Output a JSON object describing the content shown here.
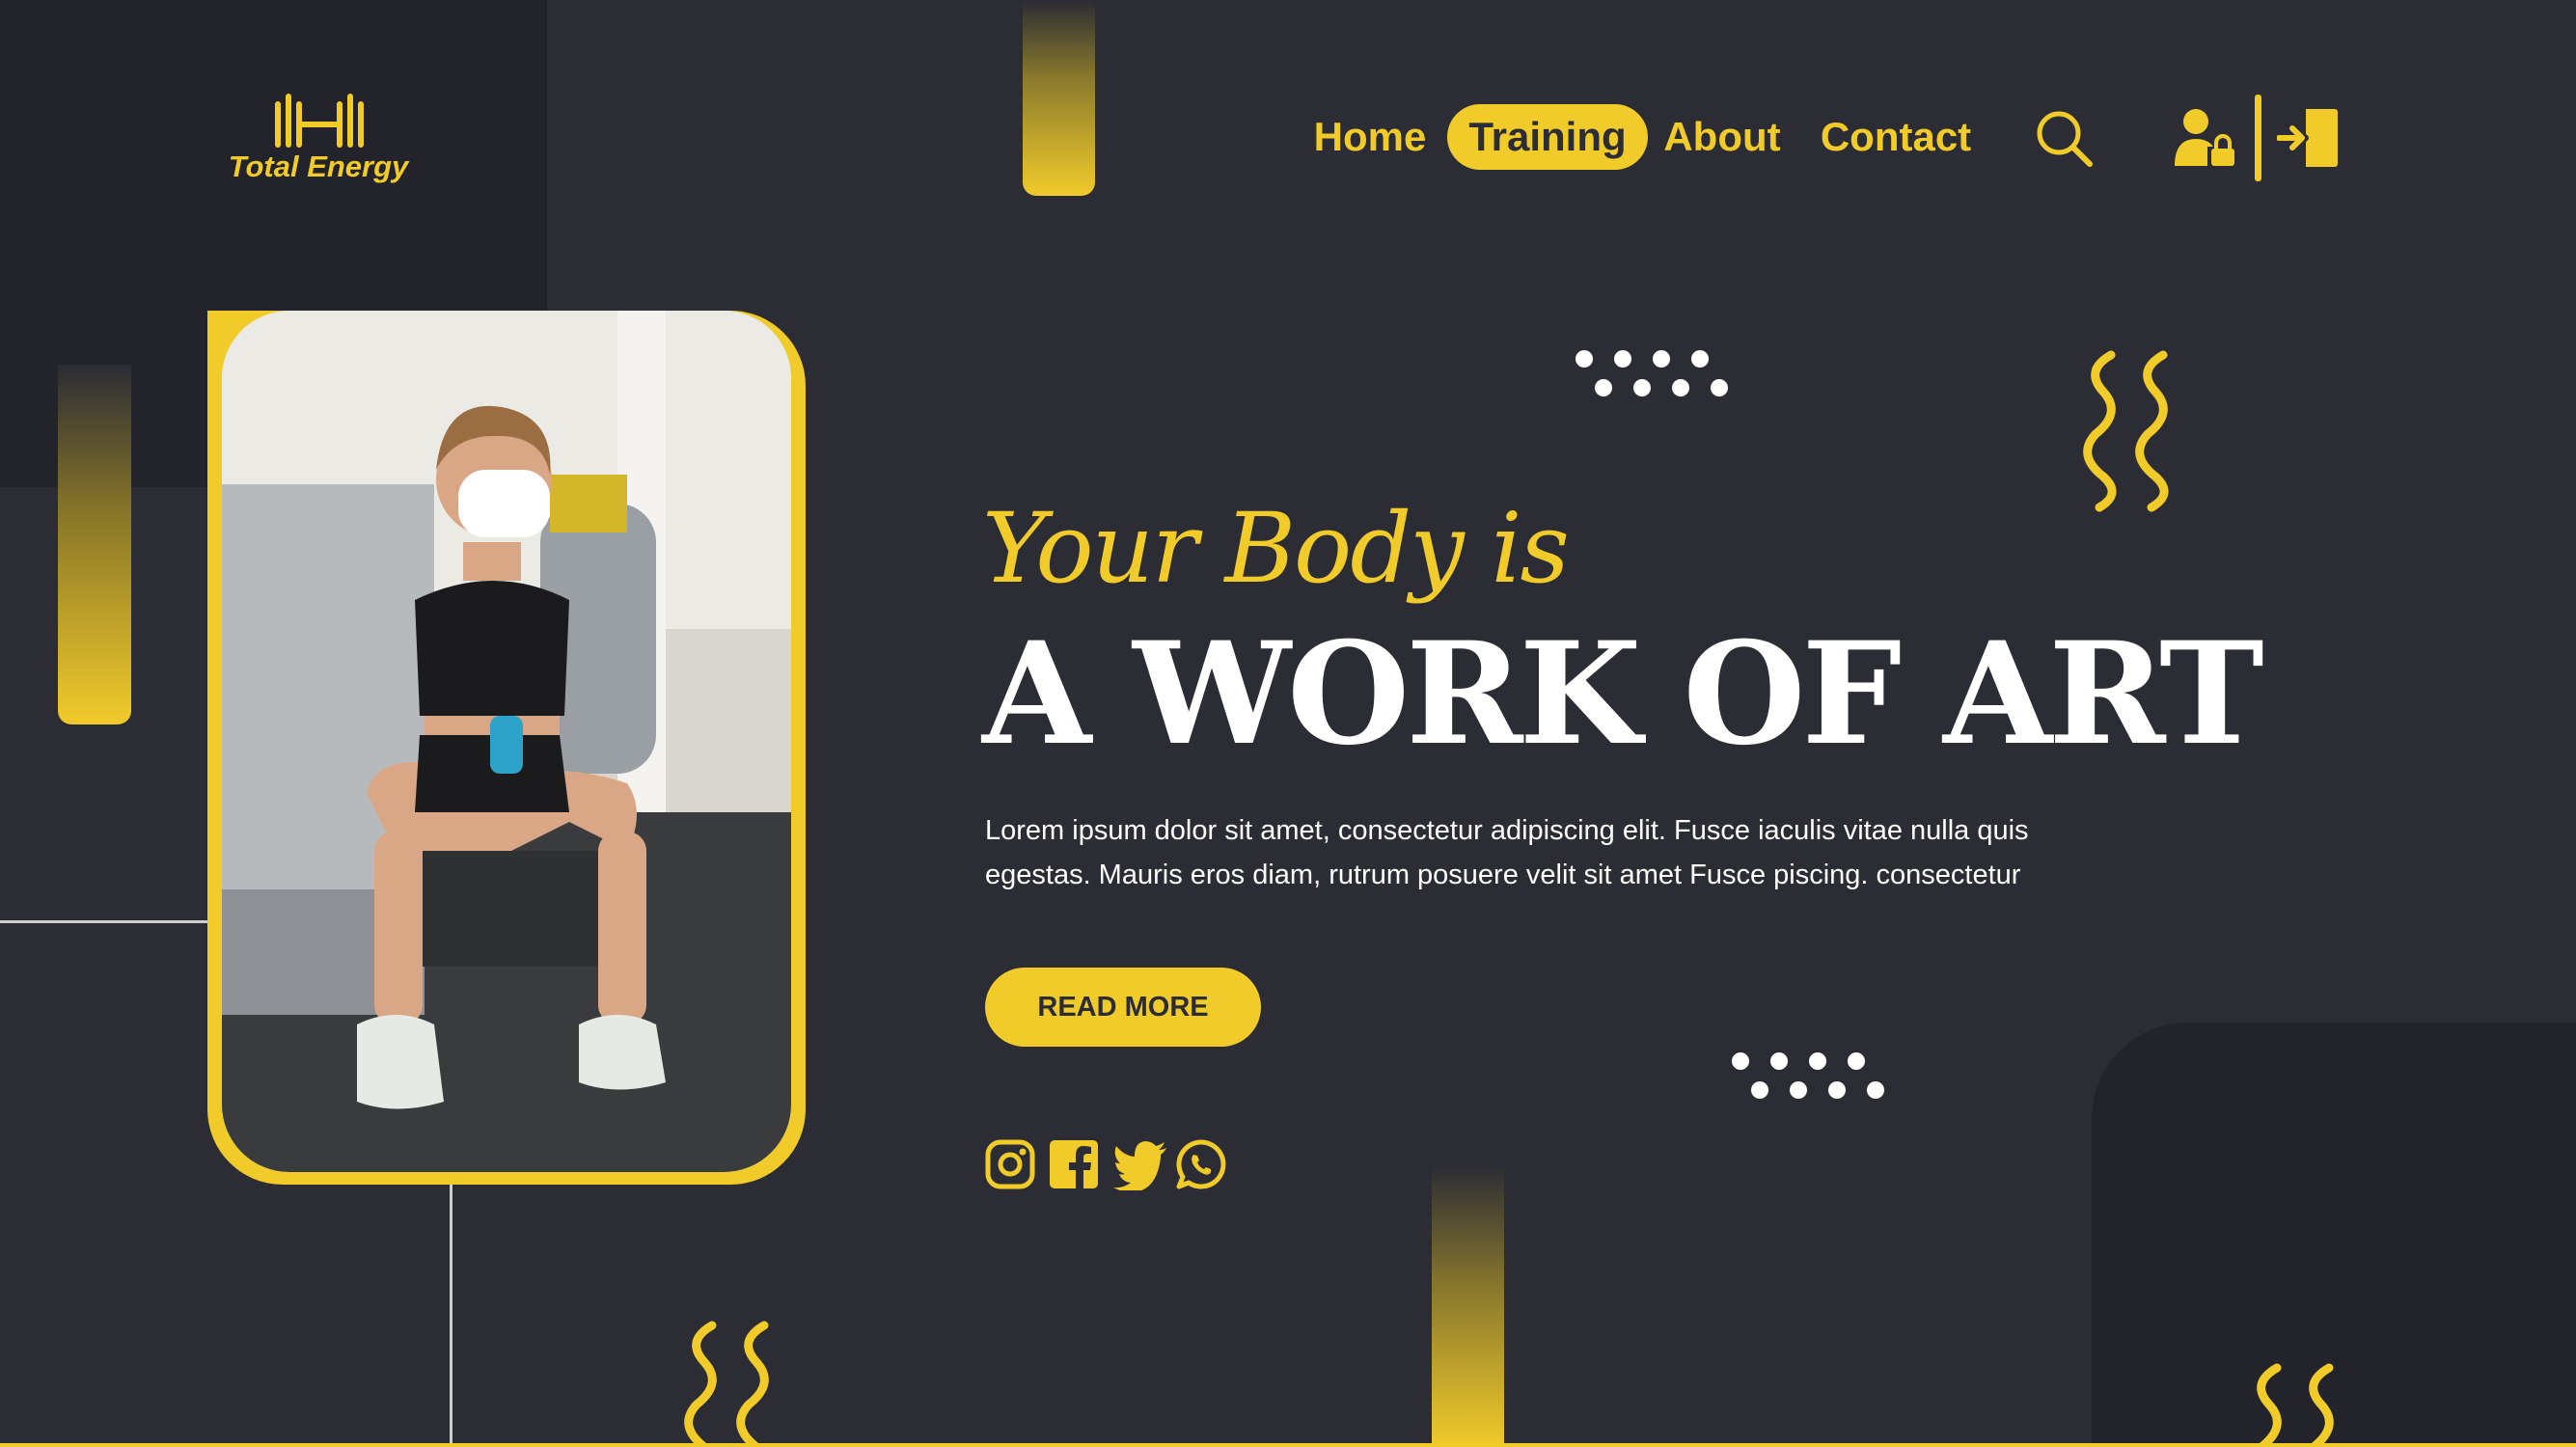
{
  "brand": {
    "name": "Total Energy"
  },
  "nav": {
    "items": [
      {
        "label": "Home",
        "active": false
      },
      {
        "label": "Training",
        "active": true
      },
      {
        "label": "About",
        "active": false
      },
      {
        "label": "Contact",
        "active": false
      }
    ],
    "icons": [
      "search-icon",
      "user-lock-icon",
      "sign-in-icon"
    ]
  },
  "hero": {
    "tagline": "Your Body is",
    "headline": "A WORK OF ART",
    "description": "Lorem ipsum dolor sit amet, consectetur adipiscing elit. Fusce iaculis vitae nulla quis egestas. Mauris eros diam, rutrum posuere velit sit amet Fusce piscing. consectetur",
    "cta_label": "READ MORE"
  },
  "social": [
    "instagram-icon",
    "facebook-icon",
    "twitter-icon",
    "whatsapp-icon"
  ],
  "colors": {
    "accent": "#f1cb2a",
    "background": "#2b2c34",
    "panel": "#23242b",
    "text": "#ffffff"
  }
}
